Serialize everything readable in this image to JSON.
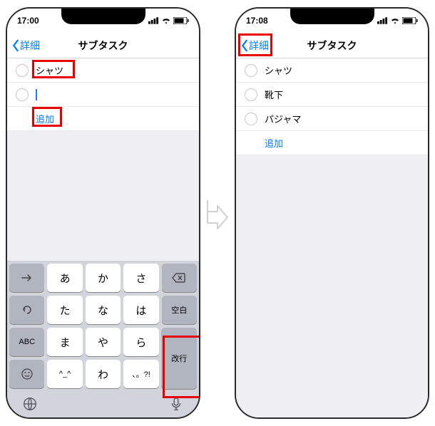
{
  "left": {
    "status_time": "17:00",
    "nav_back": "詳細",
    "nav_title": "サブタスク",
    "tasks": [
      "シャツ"
    ],
    "input_value": "",
    "add_label": "追加",
    "keyboard": {
      "rows": [
        [
          "→",
          "あ",
          "か",
          "さ",
          "⌫"
        ],
        [
          "↺",
          "た",
          "な",
          "は",
          "空白"
        ],
        [
          "ABC",
          "ま",
          "や",
          "ら",
          "改行"
        ],
        [
          "☺",
          "^_^",
          "わ",
          "、。?!",
          ""
        ]
      ]
    }
  },
  "right": {
    "status_time": "17:08",
    "nav_back": "詳細",
    "nav_title": "サブタスク",
    "tasks": [
      "シャツ",
      "靴下",
      "パジャマ"
    ],
    "add_label": "追加"
  }
}
